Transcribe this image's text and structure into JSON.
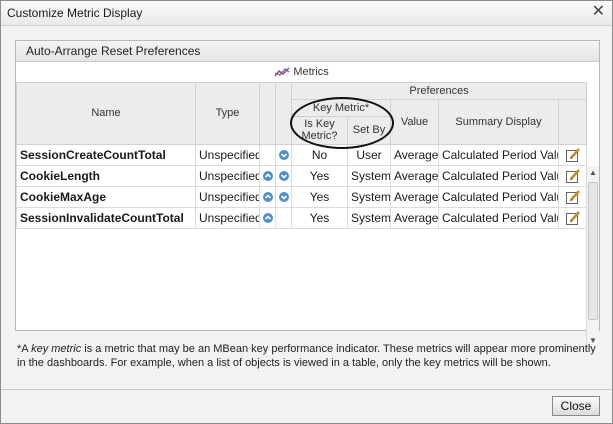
{
  "window": {
    "title": "Customize Metric Display",
    "close_glyph": "✕"
  },
  "toolbar": {
    "auto_arrange": "Auto-Arrange",
    "reset_preferences": "Reset Preferences"
  },
  "table": {
    "group_metrics": "Metrics",
    "group_preferences": "Preferences",
    "group_key_metric": "Key Metric*",
    "headers": {
      "name": "Name",
      "type": "Type",
      "is_key_metric": "Is Key Metric?",
      "set_by": "Set By",
      "value": "Value",
      "summary_display": "Summary Display"
    },
    "rows": [
      {
        "name": "SessionCreateCountTotal",
        "type": "Unspecified",
        "up": false,
        "down": true,
        "is_key": "No",
        "set_by": "User",
        "value": "Average",
        "summary": "Calculated Period Value"
      },
      {
        "name": "CookieLength",
        "type": "Unspecified",
        "up": true,
        "down": true,
        "is_key": "Yes",
        "set_by": "System",
        "value": "Average",
        "summary": "Calculated Period Value"
      },
      {
        "name": "CookieMaxAge",
        "type": "Unspecified",
        "up": true,
        "down": true,
        "is_key": "Yes",
        "set_by": "System",
        "value": "Average",
        "summary": "Calculated Period Value"
      },
      {
        "name": "SessionInvalidateCountTotal",
        "type": "Unspecified",
        "up": true,
        "down": false,
        "is_key": "Yes",
        "set_by": "System",
        "value": "Average",
        "summary": "Calculated Period Value"
      }
    ]
  },
  "footnote": {
    "prefix": "*A ",
    "term": "key metric",
    "text": "is a metric that may be an MBean key performance indicator. These metrics will appear more prominently in the dashboards. For example, when a list of objects is viewed in a table, only the key metrics will be shown."
  },
  "buttons": {
    "close": "Close"
  },
  "icons": {
    "metrics": "metrics-chart-icon",
    "up": "move-up-icon",
    "down": "move-down-icon",
    "edit": "edit-icon"
  },
  "colors": {
    "arrow": "#4a8fd4",
    "callout": "#111111"
  }
}
